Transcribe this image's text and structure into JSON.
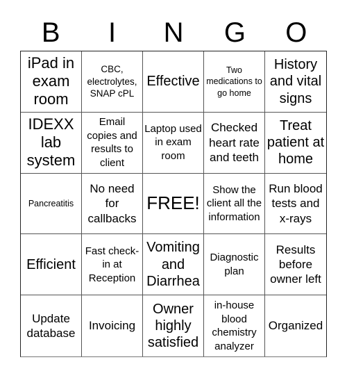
{
  "header": {
    "letters": [
      "B",
      "I",
      "N",
      "G",
      "O"
    ]
  },
  "board": {
    "cells": [
      "iPad in exam room",
      "CBC, electrolytes, SNAP cPL",
      "Effective",
      "Two medications to go home",
      "History and vital signs",
      "IDEXX lab system",
      "Email copies and results to client",
      "Laptop used in exam room",
      "Checked heart rate and teeth",
      "Treat patient at home",
      "Pancreatitis",
      "No need for callbacks",
      "FREE!",
      "Show the client all the information",
      "Run blood tests and x-rays",
      "Efficient",
      "Fast check-in at Reception",
      "Vomiting and Diarrhea",
      "Diagnostic plan",
      "Results before owner left",
      "Update database",
      "Invoicing",
      "Owner highly satisfied",
      "in-house blood chemistry analyzer",
      "Organized"
    ],
    "free_space_index": 12
  }
}
